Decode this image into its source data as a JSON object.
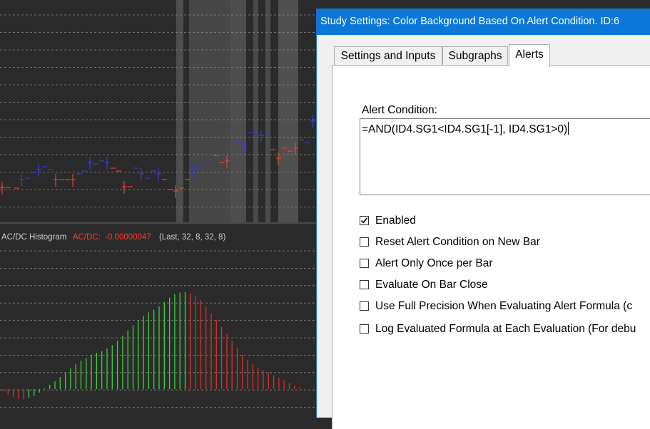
{
  "chart": {
    "histogram_label": "AC/DC Histogram",
    "acdc_label": "AC/DC:",
    "acdc_value": "-0.00000047",
    "params": "(Last, 32, 8, 32, 8)",
    "colors": {
      "background": "#2b2b2b",
      "grid": "#8a8a8a",
      "up": "#3a3ad8",
      "down": "#e0453a",
      "hist_up": "#3ad23a",
      "hist_down": "#d8322a",
      "highlight": "#4a4a4a",
      "value_text": "#ff3a2a",
      "label_text": "#cfcfcf"
    },
    "hist_values": [
      -0.1,
      -0.3,
      -0.45,
      -0.55,
      -0.6,
      -0.5,
      -0.4,
      -0.2,
      0.05,
      0.25,
      0.45,
      0.7,
      0.95,
      1.2,
      1.45,
      1.65,
      1.8,
      2.0,
      2.1,
      2.2,
      2.35,
      2.55,
      2.8,
      3.1,
      3.4,
      3.7,
      4.0,
      4.25,
      4.45,
      4.6,
      4.8,
      5.05,
      5.3,
      5.5,
      5.6,
      5.62,
      5.55,
      5.4,
      5.15,
      4.8,
      4.4,
      4.0,
      3.6,
      3.2,
      2.8,
      2.4,
      2.0,
      1.7,
      1.45,
      1.25,
      1.1,
      0.95,
      0.8,
      0.65,
      0.5,
      0.35,
      0.2,
      0.1,
      0.03,
      0.0
    ],
    "hist_colors": [
      "d",
      "d",
      "d",
      "d",
      "d",
      "u",
      "u",
      "u",
      "u",
      "u",
      "u",
      "u",
      "u",
      "u",
      "u",
      "u",
      "u",
      "u",
      "u",
      "u",
      "u",
      "u",
      "u",
      "u",
      "u",
      "u",
      "u",
      "u",
      "u",
      "u",
      "u",
      "u",
      "u",
      "u",
      "u",
      "u",
      "d",
      "d",
      "d",
      "d",
      "d",
      "d",
      "d",
      "d",
      "d",
      "d",
      "d",
      "d",
      "d",
      "d",
      "d",
      "d",
      "d",
      "d",
      "d",
      "d",
      "d",
      "d",
      "d",
      "d"
    ]
  },
  "dialog": {
    "title": "Study Settings: Color Background Based On Alert Condition. ID:6",
    "tabs": [
      "Settings and Inputs",
      "Subgraphs",
      "Alerts"
    ],
    "active_tab": "Alerts",
    "alert_condition_label": "Alert Condition:",
    "alert_condition_value": "=AND(ID4.SG1<ID4.SG1[-1], ID4.SG1>0)",
    "options": [
      {
        "label": "Enabled",
        "checked": true
      },
      {
        "label": "Reset Alert Condition on New Bar",
        "checked": false
      },
      {
        "label": "Alert Only Once per Bar",
        "checked": false
      },
      {
        "label": "Evaluate On Bar Close",
        "checked": false
      },
      {
        "label": "Use Full Precision When Evaluating Alert Formula (c",
        "checked": false
      },
      {
        "label": "Log Evaluated Formula at Each Evaluation (For debu",
        "checked": false
      }
    ]
  }
}
